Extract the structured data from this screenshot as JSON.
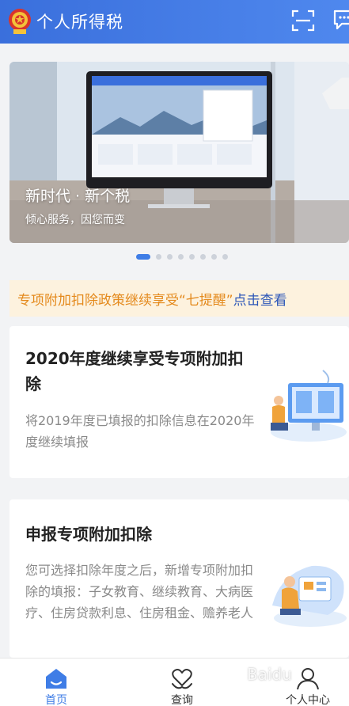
{
  "header": {
    "app_title": "个人所得税",
    "icons": {
      "emblem": "national-emblem-icon",
      "scan": "scan-icon",
      "message": "message-icon"
    },
    "colors": {
      "bar": "#3a6fdc"
    }
  },
  "banner": {
    "title": "新时代 · 新个税",
    "subtitle": "倾心服务，因您而变",
    "slide_count": 8,
    "active_index": 0
  },
  "notice": {
    "text": "专项附加扣除政策继续享受“七提醒”",
    "link": "点击查看",
    "colors": {
      "text": "#e48a1d",
      "link": "#2d57b8",
      "bg": "#fdf2de"
    }
  },
  "cards": [
    {
      "title": "2020年度继续享受专项附加扣除",
      "desc": "将2019年度已填报的扣除信息在2020年度继续填报",
      "illustration": "continue-deduction-illustration"
    },
    {
      "title": "申报专项附加扣除",
      "desc": "您可选择扣除年度之后，新增专项附加扣除的填报：子女教育、继续教育、大病医疗、住房贷款利息、住房租金、赡养老人",
      "illustration": "declare-deduction-illustration"
    }
  ],
  "bottom_nav": {
    "items": [
      {
        "label": "首页",
        "icon": "home-icon",
        "active": true
      },
      {
        "label": "查询",
        "icon": "heart-hands-icon",
        "active": false
      },
      {
        "label": "个人中心",
        "icon": "user-icon",
        "active": false
      }
    ],
    "active_color": "#3f7de6"
  },
  "watermark": "Baidu"
}
